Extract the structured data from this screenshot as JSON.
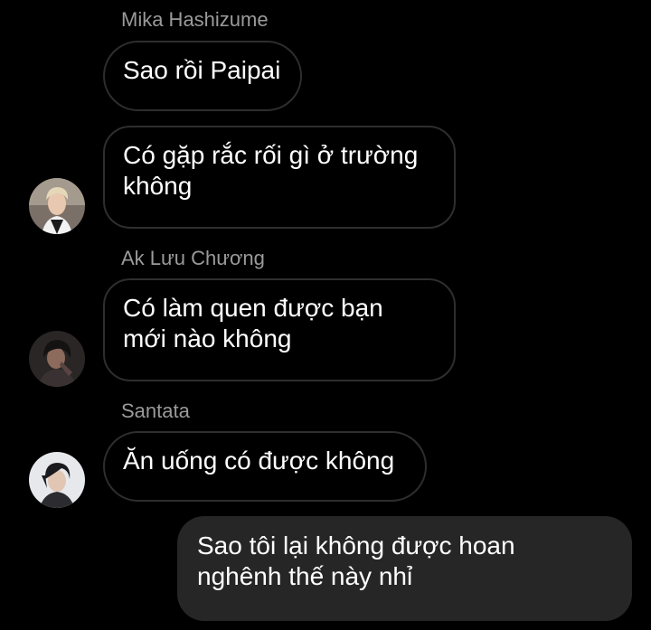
{
  "colors": {
    "background": "#000000",
    "incoming_border": "#2e2e2e",
    "outgoing_fill": "#262626",
    "sender_name": "#9a9a9a",
    "text": "#ffffff"
  },
  "messages": [
    {
      "sender": "Mika Hashizume",
      "bubbles": [
        {
          "text": "Sao rồi Paipai"
        },
        {
          "text": "Có gặp rắc rối gì ở trường\nkhông"
        }
      ],
      "avatar_icon": "avatar-blond-man-icon"
    },
    {
      "sender": "Ak Lưu Chương",
      "bubbles": [
        {
          "text": "Có làm quen được bạn\nmới nào không"
        }
      ],
      "avatar_icon": "avatar-dark-hair-man-icon"
    },
    {
      "sender": "Santata",
      "bubbles": [
        {
          "text": "Ăn uống có được không"
        }
      ],
      "avatar_icon": "avatar-dark-hair-young-man-icon"
    }
  ],
  "outgoing": {
    "text": "Sao tôi lại không được hoan\nnghênh thế này nhỉ"
  }
}
